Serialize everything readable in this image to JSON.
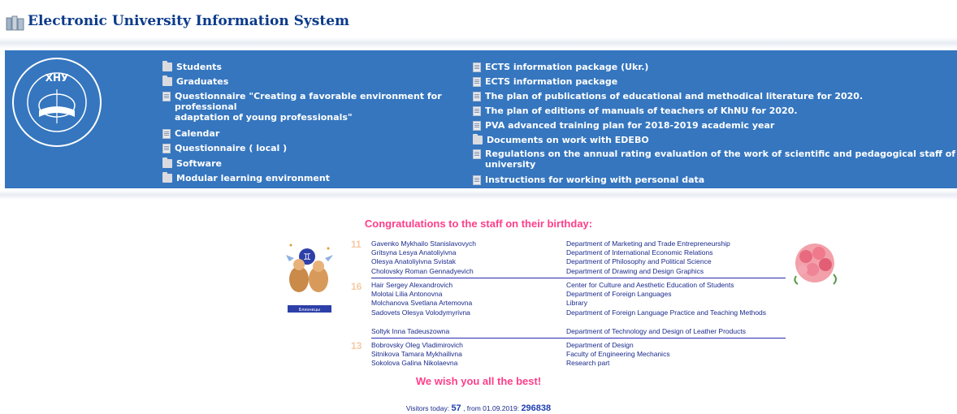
{
  "header": {
    "title": "Electronic University Information System"
  },
  "crest": {
    "text": "ХНУ"
  },
  "menu_left": [
    {
      "label": "Students",
      "icon": "folder-icon"
    },
    {
      "label": "Graduates",
      "icon": "folder-icon"
    },
    {
      "label": "Questionnaire \"Creating a favorable environment for",
      "line2": "professional",
      "line3": "adaptation of young professionals\"",
      "icon": "document-icon"
    },
    {
      "label": "Calendar",
      "icon": "document-icon"
    },
    {
      "label": "Questionnaire",
      "paren_open": "(",
      "local": "local",
      "paren_close": ")",
      "icon": "document-icon"
    },
    {
      "label": "Software",
      "icon": "folder-icon"
    },
    {
      "label": "Modular learning environment",
      "icon": "folder-icon"
    }
  ],
  "menu_right": [
    {
      "label": "ECTS information package (Ukr.)",
      "icon": "document-icon"
    },
    {
      "label": "ECTS information package",
      "icon": "document-icon"
    },
    {
      "label": "The plan of publications of educational and methodical literature for 2020.",
      "icon": "document-icon"
    },
    {
      "label": "The plan of editions of manuals of teachers of KhNU for 2020.",
      "icon": "document-icon"
    },
    {
      "label": "PVA advanced training plan for 2018-2019 academic year",
      "icon": "document-icon"
    },
    {
      "label": "Documents on work with EDEBO",
      "icon": "folder-icon"
    },
    {
      "label": "Regulations on the annual rating evaluation of the work of scientific and pedagogical staff of the",
      "line2": "university",
      "icon": "document-icon"
    },
    {
      "label": "Instructions for working with personal data",
      "icon": "document-icon"
    }
  ],
  "birthday": {
    "title": "Congratulations to the staff on their birthday:",
    "zodiac_caption": "Близнецы",
    "days": [
      "11",
      "16",
      "13"
    ],
    "rows": [
      {
        "name": "Gavenko Mykhailo Stanislavovych",
        "dept": "Department of Marketing and Trade Entrepreneurship"
      },
      {
        "name": "Gritsyna Lesya Anatoliyivna",
        "dept": "Department of International Economic Relations"
      },
      {
        "name": "Olesya Anatoliyivna Svistak",
        "dept": "Department of Philosophy and Political Science"
      },
      {
        "name": "Cholovsky Roman Gennadyevich",
        "dept": "Department of Drawing and Design Graphics"
      },
      {
        "name": "Hair Sergey Alexandrovich",
        "dept": "Center for Culture and Aesthetic Education of Students"
      },
      {
        "name": "Molotai Lilia Antonovna",
        "dept": "Department of Foreign Languages"
      },
      {
        "name": "Molchanova Svetlana Artemovna",
        "dept": "Library"
      },
      {
        "name": "Sadovets Olesya Volodymyrivna",
        "dept": "Department of Foreign Language Practice and Teaching Methods"
      },
      {
        "name": "Soltyk Inna Tadeuszowna",
        "dept": "Department of Technology and Design of Leather Products"
      },
      {
        "name": "Bobrovsky Oleg Vladimirovich",
        "dept": "Department of Design"
      },
      {
        "name": "Sitnikova Tamara Mykhailivna",
        "dept": "Faculty of Engineering Mechanics"
      },
      {
        "name": "Sokolova Galina Nikolaevna",
        "dept": "Research part"
      }
    ],
    "wish": "We wish you all the best!"
  },
  "visitors": {
    "today_label": "Visitors today:",
    "today_value": "57",
    "since_label": ", from 01.09.2019:",
    "since_value": "296838"
  },
  "colors": {
    "band": "#3576bf",
    "title": "#0b3a8a",
    "pink": "#ff3e8a",
    "navy": "#1a2a8c"
  }
}
